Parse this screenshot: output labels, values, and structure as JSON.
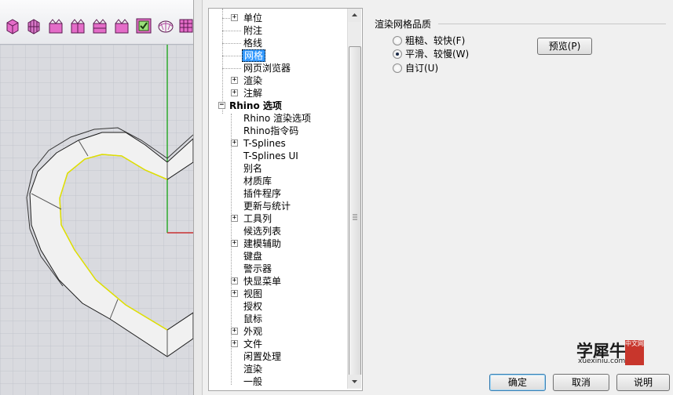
{
  "toolbar": {
    "icons": [
      "box-3d-icon",
      "box-grid-icon",
      "box-edges-icon",
      "box-edges-icon",
      "box-edges-icon",
      "box-edges-icon",
      "checkbox-toggle-icon",
      "sphere-icon",
      "grid-toggle-icon"
    ]
  },
  "tree": {
    "items": [
      {
        "label": "单位"
      },
      {
        "label": "附注"
      },
      {
        "label": "格线"
      },
      {
        "label": "网格"
      },
      {
        "label": "网页浏览器"
      },
      {
        "label": "渲染"
      },
      {
        "label": "注解"
      },
      {
        "label": "Rhino 选项"
      },
      {
        "label": "Rhino 渲染选项"
      },
      {
        "label": "Rhino指令码"
      },
      {
        "label": "T-Splines"
      },
      {
        "label": "T-Splines UI"
      },
      {
        "label": "别名"
      },
      {
        "label": "材质库"
      },
      {
        "label": "插件程序"
      },
      {
        "label": "更新与统计"
      },
      {
        "label": "工具列"
      },
      {
        "label": "候选列表"
      },
      {
        "label": "建模辅助"
      },
      {
        "label": "键盘"
      },
      {
        "label": "警示器"
      },
      {
        "label": "快显菜单"
      },
      {
        "label": "视图"
      },
      {
        "label": "授权"
      },
      {
        "label": "鼠标"
      },
      {
        "label": "外观"
      },
      {
        "label": "文件"
      },
      {
        "label": "闲置处理"
      },
      {
        "label": "渲染"
      },
      {
        "label": "一般"
      }
    ],
    "selected": "网格"
  },
  "mesh_quality": {
    "group_title": "渲染网格品质",
    "options": [
      {
        "label": "粗糙、较快(F)",
        "checked": false
      },
      {
        "label": "平滑、较慢(W)",
        "checked": true
      },
      {
        "label": "自订(U)",
        "checked": false
      }
    ],
    "preview_button": "预览(P)"
  },
  "footer": {
    "ok": "确定",
    "cancel": "取消",
    "help": "说明"
  },
  "watermark": {
    "main": "学犀牛",
    "url": "xuexiniu.com",
    "badge": "中文网"
  },
  "colors": {
    "selection": "#3399ff",
    "viewport_bg": "#d9dadf",
    "y_axis": "#2faa2f",
    "x_axis": "#c83030",
    "curve_highlight": "#e0e000"
  }
}
